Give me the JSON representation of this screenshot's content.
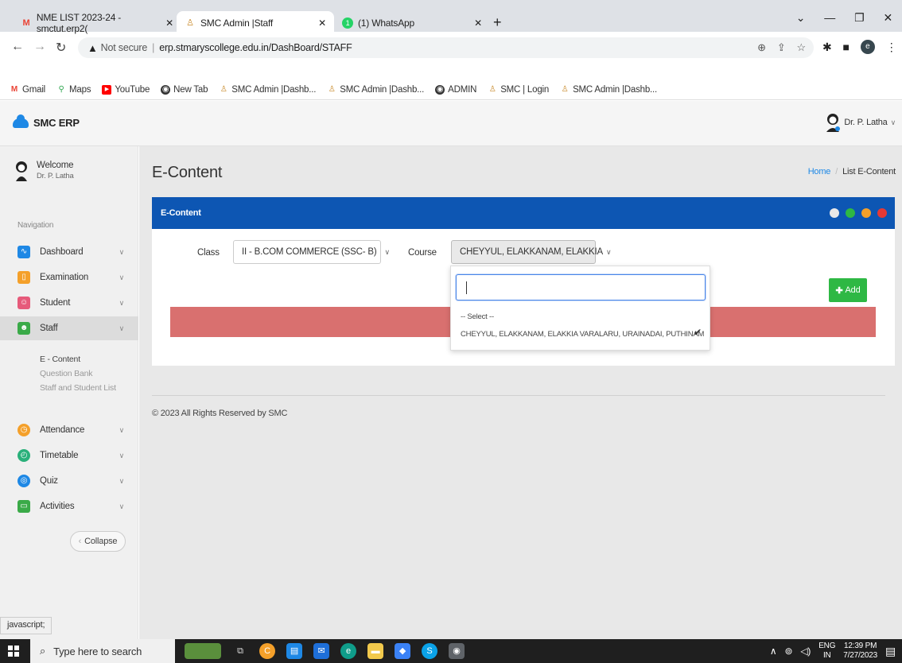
{
  "browser": {
    "tabs": [
      {
        "title": "NME LIST 2023-24 - smctut.erp2(",
        "icon": "gmail-icon",
        "active": false
      },
      {
        "title": "SMC Admin |Staff",
        "icon": "smc-icon",
        "active": true
      },
      {
        "title": "(1) WhatsApp",
        "icon": "whatsapp-icon",
        "active": false
      }
    ],
    "new_tab": "+",
    "security": "Not secure",
    "url": "erp.stmaryscollege.edu.in/DashBoard/STAFF",
    "profile_initial": "e",
    "bookmarks": [
      {
        "label": "Gmail",
        "icon": "gmail-icon",
        "color": "#ea4335"
      },
      {
        "label": "Maps",
        "icon": "maps-icon",
        "color": "#34a853"
      },
      {
        "label": "YouTube",
        "icon": "youtube-icon",
        "color": "#ff0000"
      },
      {
        "label": "New Tab",
        "icon": "globe-icon",
        "color": "#333333"
      },
      {
        "label": "SMC Admin |Dashb...",
        "icon": "smc-icon",
        "color": "#c98a2b"
      },
      {
        "label": "SMC Admin |Dashb...",
        "icon": "smc-icon",
        "color": "#c98a2b"
      },
      {
        "label": "ADMIN",
        "icon": "globe-icon",
        "color": "#333333"
      },
      {
        "label": "SMC | Login",
        "icon": "smc-icon",
        "color": "#c98a2b"
      },
      {
        "label": "SMC Admin |Dashb...",
        "icon": "smc-icon",
        "color": "#c98a2b"
      }
    ]
  },
  "app": {
    "logo": "SMC ERP",
    "user": "Dr. P. Latha",
    "welcome": "Welcome",
    "welcome_name": "Dr. P. Latha",
    "nav_label": "Navigation",
    "nav": [
      {
        "label": "Dashboard",
        "icon": "dashboard-icon",
        "color": "#1e88e5"
      },
      {
        "label": "Examination",
        "icon": "book-icon",
        "color": "#f4a02a"
      },
      {
        "label": "Student",
        "icon": "student-icon",
        "color": "#e65a7a"
      },
      {
        "label": "Staff",
        "icon": "staff-icon",
        "color": "#3aaa48"
      },
      {
        "label": "Attendance",
        "icon": "clock-icon",
        "color": "#f4a02a"
      },
      {
        "label": "Timetable",
        "icon": "timetable-icon",
        "color": "#2ab07a"
      },
      {
        "label": "Quiz",
        "icon": "quiz-icon",
        "color": "#1e88e5"
      },
      {
        "label": "Activities",
        "icon": "folder-icon",
        "color": "#3aaa48"
      }
    ],
    "staff_sub": [
      "E - Content",
      "Question Bank",
      "Staff and Student List"
    ],
    "collapse": "Collapse"
  },
  "page": {
    "title": "E-Content",
    "breadcrumb_home": "Home",
    "breadcrumb_current": "List E-Content",
    "card_title": "E-Content",
    "class_label": "Class",
    "class_value": "II - B.COM COMMERCE (SSC- B)",
    "course_label": "Course",
    "course_value": "CHEYYUL, ELAKKANAM, ELAKKIA",
    "dropdown_search": "",
    "dropdown_options": [
      "-- Select --",
      "CHEYYUL, ELAKKANAM, ELAKKIA VARALARU, URAINADAI, PUTHINAM"
    ],
    "add_button": "Add",
    "footer": "© 2023 All Rights Reserved by SMC",
    "status_link": "javascript;",
    "colors": {
      "header_blue": "#0d56b3",
      "alert": "#d9706f",
      "add_green": "#2eb844"
    }
  },
  "taskbar": {
    "search_placeholder": "Type here to search",
    "lang1": "ENG",
    "lang2": "IN",
    "time": "12:39 PM",
    "date": "7/27/2023"
  }
}
